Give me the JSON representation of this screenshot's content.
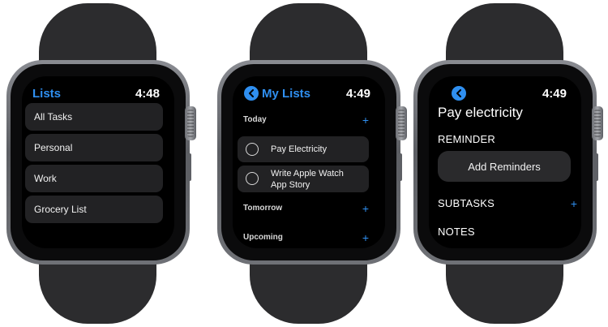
{
  "watches": [
    {
      "title": "Lists",
      "time": "4:48",
      "lists": [
        "All Tasks",
        "Personal",
        "Work",
        "Grocery List"
      ]
    },
    {
      "title": "My Lists",
      "time": "4:49",
      "back_icon": "chevron-left-icon",
      "sections": {
        "today": "Today",
        "tomorrow": "Tomorrow",
        "upcoming": "Upcoming"
      },
      "add_glyph": "+",
      "tasks": [
        {
          "line1": "Pay Electricity",
          "line2": ""
        },
        {
          "line1": "Write Apple Watch",
          "line2": "App Story"
        }
      ]
    },
    {
      "time": "4:49",
      "back_icon": "chevron-left-icon",
      "task_title": "Pay electricity",
      "reminder_label": "REMINDER",
      "add_reminders_label": "Add Reminders",
      "subtasks_label": "SUBTASKS",
      "notes_label": "NOTES",
      "add_glyph": "+"
    }
  ],
  "colors": {
    "accent": "#2f8ff0",
    "screen": "#000000",
    "cell": "#222224",
    "band": "#2c2c2e"
  }
}
